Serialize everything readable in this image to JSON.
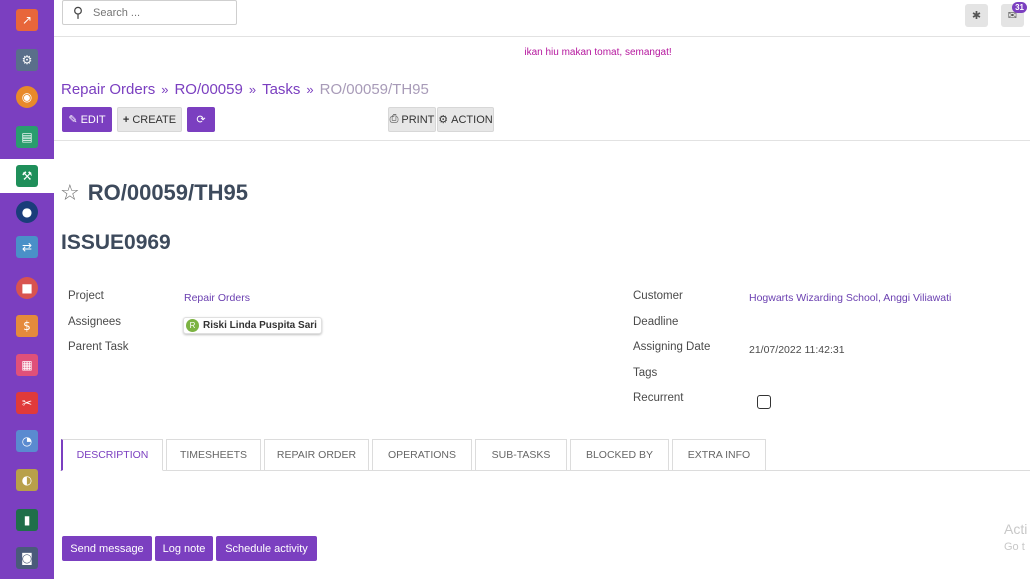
{
  "sidebar": {
    "items": [
      {
        "icon": "chart-icon",
        "glyph": "↗",
        "color": "#e8663a"
      },
      {
        "icon": "handshake-icon",
        "glyph": "⚙",
        "color": "#5a6f8a"
      },
      {
        "icon": "globe-icon",
        "glyph": "◉",
        "color": "#e88a2a"
      },
      {
        "icon": "presentation-icon",
        "glyph": "▤",
        "color": "#2a9d6e"
      },
      {
        "icon": "repair-icon",
        "glyph": "⚒",
        "color": "#1f8f5a",
        "active": true
      },
      {
        "icon": "company-icon",
        "glyph": "●",
        "color": "#1a3d7a"
      },
      {
        "icon": "inventory-icon",
        "glyph": "⇄",
        "color": "#4a90c8"
      },
      {
        "icon": "notes-icon",
        "glyph": "■",
        "color": "#d8534f"
      },
      {
        "icon": "invoice-icon",
        "glyph": "$",
        "color": "#e58a3c"
      },
      {
        "icon": "pos-icon",
        "glyph": "▦",
        "color": "#e0507a"
      },
      {
        "icon": "manufacturing-icon",
        "glyph": "✂",
        "color": "#e03a3a"
      },
      {
        "icon": "employee-icon",
        "glyph": "◔",
        "color": "#5a8ad0"
      },
      {
        "icon": "attendance-icon",
        "glyph": "◐",
        "color": "#b8a04a"
      },
      {
        "icon": "board-icon",
        "glyph": "▮",
        "color": "#1f6f4a"
      },
      {
        "icon": "fleet-icon",
        "glyph": "◙",
        "color": "#4a5a7a"
      }
    ]
  },
  "search": {
    "placeholder": "Search ..."
  },
  "topbar": {
    "messages_badge": "31"
  },
  "announcement": "ikan hiu makan tomat, semangat!",
  "breadcrumb": {
    "items": [
      "Repair Orders",
      "RO/00059",
      "Tasks"
    ],
    "current": "RO/00059/TH95"
  },
  "toolbar": {
    "edit": "EDIT",
    "create": "CREATE",
    "print": "PRINT",
    "action": "ACTION"
  },
  "record": {
    "title": "RO/00059/TH95",
    "issue": "ISSUE0969"
  },
  "fields": {
    "project_label": "Project",
    "project_value": "Repair Orders",
    "assignees_label": "Assignees",
    "assignee_initial": "R",
    "assignee_name": "Riski Linda Puspita Sari",
    "parent_label": "Parent Task",
    "customer_label": "Customer",
    "customer_value": "Hogwarts Wizarding School, Anggi Viliawati",
    "deadline_label": "Deadline",
    "assigning_label": "Assigning Date",
    "assigning_value": "21/07/2022 11:42:31",
    "tags_label": "Tags",
    "recurrent_label": "Recurrent",
    "recurrent_checked": false
  },
  "tabs": [
    "DESCRIPTION",
    "TIMESHEETS",
    "REPAIR ORDER",
    "OPERATIONS",
    "SUB-TASKS",
    "BLOCKED BY",
    "EXTRA INFO"
  ],
  "chatter": {
    "send_message": "Send message",
    "log_note": "Log note",
    "schedule_activity": "Schedule activity"
  },
  "watermark": {
    "line1": "Acti",
    "line2": "Go t"
  }
}
